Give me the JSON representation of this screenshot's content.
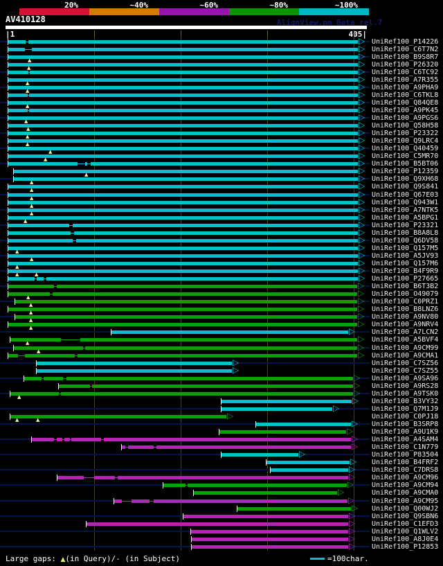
{
  "header": {
    "query_id": "AV410128",
    "app_credit": "AlignView.pm Beta rel.7",
    "ruler_left": "|1",
    "ruler_right": "405|"
  },
  "identity_scale": {
    "items": [
      {
        "label": "20%",
        "color": "#d01434"
      },
      {
        "label": "~40%",
        "color": "#d57a00"
      },
      {
        "label": "~60%",
        "color": "#9715ad"
      },
      {
        "label": "~80%",
        "color": "#0c9500"
      },
      {
        "label": "~100%",
        "color": "#00b6c4"
      }
    ]
  },
  "colors": {
    "cyan": "#00c2cc",
    "green": "#0aa004",
    "magenta": "#b524b5",
    "row_line": "#041348",
    "gridline": "#45451c",
    "query_gap_mark": "#f2f2a0",
    "label_text": "#f0f0f0"
  },
  "legend": {
    "gaps_prefix": "Large gaps: ",
    "gap_query_symbol": "▲",
    "gaps_mid": "(in Query)/",
    "gap_subject_symbol": "-",
    "gaps_suffix": " (in Subject)",
    "scale_label": "=100char."
  },
  "chart_data": {
    "type": "bar",
    "subtype": "sequence-alignment-overview",
    "title": "AV410128",
    "query": {
      "id": "AV410128",
      "length": 405
    },
    "axis": {
      "start": 1,
      "end": 405,
      "gridlines": [
        100,
        200,
        300,
        400
      ]
    },
    "identity_bins": [
      {
        "label": "20%",
        "color_key": "red"
      },
      {
        "label": "~40%",
        "color_key": "orange"
      },
      {
        "label": "~60%",
        "color_key": "magenta"
      },
      {
        "label": "~80%",
        "color_key": "green"
      },
      {
        "label": "~100%",
        "color_key": "cyan"
      }
    ],
    "rows": [
      {
        "label": "UniRef100_P14226",
        "color": "cyan",
        "identity": "~100%",
        "start": 1,
        "end": 405,
        "qg": [],
        "sg": [
          [
            21,
            24
          ]
        ]
      },
      {
        "label": "UniRef100_C6T7N2",
        "color": "cyan",
        "identity": "~100%",
        "start": 1,
        "end": 405,
        "qg": [],
        "sg": [
          [
            20,
            28
          ]
        ]
      },
      {
        "label": "UniRef100_B9S8R7",
        "color": "cyan",
        "identity": "~100%",
        "start": 1,
        "end": 405,
        "qg": [
          26
        ],
        "sg": []
      },
      {
        "label": "UniRef100_P26320",
        "color": "cyan",
        "identity": "~100%",
        "start": 1,
        "end": 405,
        "qg": [
          25
        ],
        "sg": []
      },
      {
        "label": "UniRef100_C6TC92",
        "color": "cyan",
        "identity": "~100%",
        "start": 1,
        "end": 405,
        "qg": [],
        "sg": [
          [
            24,
            26
          ]
        ]
      },
      {
        "label": "UniRef100_A7R355",
        "color": "cyan",
        "identity": "~100%",
        "start": 1,
        "end": 405,
        "qg": [
          23
        ],
        "sg": []
      },
      {
        "label": "UniRef100_A9PHA9",
        "color": "cyan",
        "identity": "~100%",
        "start": 1,
        "end": 405,
        "qg": [
          23
        ],
        "sg": []
      },
      {
        "label": "UniRef100_C6TKL8",
        "color": "cyan",
        "identity": "~100%",
        "start": 1,
        "end": 405,
        "qg": [],
        "sg": [
          [
            23,
            25
          ]
        ]
      },
      {
        "label": "UniRef100_Q84QE8",
        "color": "cyan",
        "identity": "~100%",
        "start": 1,
        "end": 405,
        "qg": [
          23
        ],
        "sg": []
      },
      {
        "label": "UniRef100_A9PK45",
        "color": "cyan",
        "identity": "~100%",
        "start": 1,
        "end": 405,
        "qg": [],
        "sg": [
          [
            23,
            24
          ]
        ]
      },
      {
        "label": "UniRef100_A9PGS6",
        "color": "cyan",
        "identity": "~100%",
        "start": 1,
        "end": 405,
        "qg": [
          22
        ],
        "sg": []
      },
      {
        "label": "UniRef100_Q58H58",
        "color": "cyan",
        "identity": "~100%",
        "start": 1,
        "end": 405,
        "qg": [
          24
        ],
        "sg": []
      },
      {
        "label": "UniRef100_P23322",
        "color": "cyan",
        "identity": "~100%",
        "start": 1,
        "end": 405,
        "qg": [
          23
        ],
        "sg": []
      },
      {
        "label": "UniRef100_Q9LRC4",
        "color": "cyan",
        "identity": "~100%",
        "start": 1,
        "end": 405,
        "qg": [
          23
        ],
        "sg": []
      },
      {
        "label": "UniRef100_Q40459",
        "color": "cyan",
        "identity": "~100%",
        "start": 1,
        "end": 405,
        "qg": [
          50
        ],
        "sg": []
      },
      {
        "label": "UniRef100_C5MR70",
        "color": "cyan",
        "identity": "~100%",
        "start": 1,
        "end": 405,
        "qg": [
          44
        ],
        "sg": []
      },
      {
        "label": "UniRef100_B5BT06",
        "color": "cyan",
        "identity": "~100%",
        "start": 1,
        "end": 405,
        "qg": [],
        "sg": [
          [
            81,
            90
          ],
          [
            92,
            96
          ]
        ]
      },
      {
        "label": "UniRef100_P12359",
        "color": "cyan",
        "identity": "~100%",
        "start": 7,
        "end": 405,
        "qg": [
          91
        ],
        "sg": []
      },
      {
        "label": "UniRef100_Q9XH68",
        "color": "cyan",
        "identity": "~100%",
        "start": 7,
        "end": 405,
        "qg": [
          28
        ],
        "sg": []
      },
      {
        "label": "UniRef100_Q9S841",
        "color": "cyan",
        "identity": "~100%",
        "start": 1,
        "end": 405,
        "qg": [
          28
        ],
        "sg": []
      },
      {
        "label": "UniRef100_Q67E03",
        "color": "cyan",
        "identity": "~100%",
        "start": 1,
        "end": 405,
        "qg": [
          28
        ],
        "sg": []
      },
      {
        "label": "UniRef100_Q943W1",
        "color": "cyan",
        "identity": "~100%",
        "start": 1,
        "end": 405,
        "qg": [
          28
        ],
        "sg": []
      },
      {
        "label": "UniRef100_A7NTK5",
        "color": "cyan",
        "identity": "~100%",
        "start": 1,
        "end": 405,
        "qg": [
          28
        ],
        "sg": []
      },
      {
        "label": "UniRef100_A5BPG1",
        "color": "cyan",
        "identity": "~100%",
        "start": 1,
        "end": 405,
        "qg": [
          21
        ],
        "sg": []
      },
      {
        "label": "UniRef100_P23321",
        "color": "cyan",
        "identity": "~100%",
        "start": 1,
        "end": 405,
        "qg": [],
        "sg": [
          [
            71,
            75
          ]
        ]
      },
      {
        "label": "UniRef100_B8A8L8",
        "color": "cyan",
        "identity": "~100%",
        "start": 1,
        "end": 405,
        "qg": [],
        "sg": [
          [
            73,
            77
          ]
        ]
      },
      {
        "label": "UniRef100_Q6DV58",
        "color": "cyan",
        "identity": "~100%",
        "start": 1,
        "end": 405,
        "qg": [],
        "sg": [
          [
            75,
            79
          ]
        ]
      },
      {
        "label": "UniRef100_Q157M5",
        "color": "cyan",
        "identity": "~100%",
        "start": 1,
        "end": 405,
        "qg": [
          11
        ],
        "sg": []
      },
      {
        "label": "UniRef100_A5JV93",
        "color": "cyan",
        "identity": "~100%",
        "start": 1,
        "end": 405,
        "qg": [
          28
        ],
        "sg": []
      },
      {
        "label": "UniRef100_Q157M6",
        "color": "cyan",
        "identity": "~100%",
        "start": 1,
        "end": 405,
        "qg": [
          11
        ],
        "sg": []
      },
      {
        "label": "UniRef100_B4F9R9",
        "color": "cyan",
        "identity": "~100%",
        "start": 1,
        "end": 405,
        "qg": [
          11,
          34
        ],
        "sg": []
      },
      {
        "label": "UniRef100_P27665",
        "color": "cyan",
        "identity": "~100%",
        "start": 1,
        "end": 405,
        "qg": [],
        "sg": [
          [
            31,
            34
          ],
          [
            42,
            45
          ]
        ]
      },
      {
        "label": "UniRef100_B6T3B2",
        "color": "green",
        "identity": "~80%",
        "start": 1,
        "end": 404,
        "qg": [],
        "sg": [
          [
            54,
            57
          ]
        ]
      },
      {
        "label": "UniRef100_O49079",
        "color": "green",
        "identity": "~80%",
        "start": 1,
        "end": 404,
        "qg": [
          24
        ],
        "sg": [
          [
            49,
            52
          ]
        ]
      },
      {
        "label": "UniRef100_C0PRZ1",
        "color": "green",
        "identity": "~80%",
        "start": 9,
        "end": 404,
        "qg": [
          27
        ],
        "sg": []
      },
      {
        "label": "UniRef100_B8LNZ6",
        "color": "green",
        "identity": "~80%",
        "start": 1,
        "end": 404,
        "qg": [
          27
        ],
        "sg": []
      },
      {
        "label": "UniRef100_A9NV80",
        "color": "green",
        "identity": "~80%",
        "start": 9,
        "end": 404,
        "qg": [
          27
        ],
        "sg": []
      },
      {
        "label": "UniRef100_A9NRV4",
        "color": "green",
        "identity": "~80%",
        "start": 1,
        "end": 404,
        "qg": [
          27
        ],
        "sg": []
      },
      {
        "label": "UniRef100_A7LCN2",
        "color": "cyan",
        "identity": "~100%",
        "start": 120,
        "end": 394,
        "qg": [],
        "sg": []
      },
      {
        "label": "UniRef100_A5BVF4",
        "color": "green",
        "identity": "~80%",
        "start": 3,
        "end": 404,
        "qg": [
          23
        ],
        "sg": [
          [
            62,
            84
          ]
        ]
      },
      {
        "label": "UniRef100_A9CM99",
        "color": "green",
        "identity": "~80%",
        "start": 7,
        "end": 404,
        "qg": [
          36
        ],
        "sg": [
          [
            87,
            90
          ]
        ]
      },
      {
        "label": "UniRef100_A9CMA1",
        "color": "green",
        "identity": "~80%",
        "start": 1,
        "end": 404,
        "qg": [],
        "sg": [
          [
            12,
            20
          ],
          [
            78,
            81
          ]
        ]
      },
      {
        "label": "UniRef100_C7SZ56",
        "color": "cyan",
        "identity": "~100%",
        "start": 34,
        "end": 259,
        "qg": [],
        "sg": []
      },
      {
        "label": "UniRef100_C7SZ55",
        "color": "cyan",
        "identity": "~100%",
        "start": 34,
        "end": 259,
        "qg": [],
        "sg": []
      },
      {
        "label": "UniRef100_A9SA96",
        "color": "green",
        "identity": "~80%",
        "start": 19,
        "end": 399,
        "qg": [],
        "sg": [
          [
            39,
            42
          ],
          [
            64,
            68
          ]
        ]
      },
      {
        "label": "UniRef100_A9RS28",
        "color": "green",
        "identity": "~80%",
        "start": 59,
        "end": 399,
        "qg": [],
        "sg": [
          [
            95,
            98
          ]
        ]
      },
      {
        "label": "UniRef100_A9TSK0",
        "color": "green",
        "identity": "~80%",
        "start": 3,
        "end": 399,
        "qg": [
          14
        ],
        "sg": [
          [
            59,
            62
          ]
        ]
      },
      {
        "label": "UniRef100_B3VY32",
        "color": "cyan",
        "identity": "~100%",
        "start": 247,
        "end": 398,
        "qg": [],
        "sg": []
      },
      {
        "label": "UniRef100_Q7M1J9",
        "color": "cyan",
        "identity": "~100%",
        "start": 247,
        "end": 375,
        "qg": [],
        "sg": []
      },
      {
        "label": "UniRef100_C0PJ18",
        "color": "green",
        "identity": "~80%",
        "start": 3,
        "end": 253,
        "qg": [
          11,
          35
        ],
        "sg": []
      },
      {
        "label": "UniRef100_B3SRP8",
        "color": "cyan",
        "identity": "~100%",
        "start": 287,
        "end": 397,
        "qg": [],
        "sg": []
      },
      {
        "label": "UniRef100_A9U1K9",
        "color": "green",
        "identity": "~80%",
        "start": 245,
        "end": 391,
        "qg": [],
        "sg": []
      },
      {
        "label": "UniRef100_A4SAM4",
        "color": "magenta",
        "identity": "~60%",
        "start": 28,
        "end": 397,
        "qg": [],
        "sg": [
          [
            54,
            57
          ],
          [
            63,
            66
          ],
          [
            72,
            74
          ],
          [
            108,
            111
          ]
        ]
      },
      {
        "label": "UniRef100_C1N779",
        "color": "magenta",
        "identity": "~60%",
        "start": 132,
        "end": 397,
        "qg": [],
        "sg": [
          [
            136,
            139
          ],
          [
            169,
            172
          ]
        ]
      },
      {
        "label": "UniRef100_P83504",
        "color": "cyan",
        "identity": "~100%",
        "start": 247,
        "end": 336,
        "qg": [],
        "sg": []
      },
      {
        "label": "UniRef100_B4FRF2",
        "color": "cyan",
        "identity": "~100%",
        "start": 299,
        "end": 395,
        "qg": [],
        "sg": []
      },
      {
        "label": "UniRef100_C7DRS8",
        "color": "cyan",
        "identity": "~100%",
        "start": 304,
        "end": 394,
        "qg": [],
        "sg": []
      },
      {
        "label": "UniRef100_A9CM96",
        "color": "magenta",
        "identity": "~60%",
        "start": 58,
        "end": 394,
        "qg": [],
        "sg": [
          [
            88,
            100
          ],
          [
            124,
            127
          ]
        ]
      },
      {
        "label": "UniRef100_A9CM94",
        "color": "green",
        "identity": "~80%",
        "start": 180,
        "end": 392,
        "qg": [],
        "sg": [
          [
            206,
            208
          ]
        ]
      },
      {
        "label": "UniRef100_A9CMA0",
        "color": "green",
        "identity": "~80%",
        "start": 215,
        "end": 381,
        "qg": [],
        "sg": []
      },
      {
        "label": "UniRef100_A9CM95",
        "color": "magenta",
        "identity": "~60%",
        "start": 123,
        "end": 393,
        "qg": [],
        "sg": [
          [
            132,
            143
          ],
          [
            164,
            169
          ]
        ]
      },
      {
        "label": "UniRef100_Q00WJ2",
        "color": "green",
        "identity": "~80%",
        "start": 266,
        "end": 397,
        "qg": [],
        "sg": []
      },
      {
        "label": "UniRef100_Q9SBN6",
        "color": "magenta",
        "identity": "~60%",
        "start": 203,
        "end": 394,
        "qg": [],
        "sg": []
      },
      {
        "label": "UniRef100_C1EFD3",
        "color": "magenta",
        "identity": "~60%",
        "start": 91,
        "end": 394,
        "qg": [],
        "sg": []
      },
      {
        "label": "UniRef100_Q1WLV2",
        "color": "magenta",
        "identity": "~60%",
        "start": 212,
        "end": 394,
        "qg": [],
        "sg": []
      },
      {
        "label": "UniRef100_A8J0E4",
        "color": "magenta",
        "identity": "~60%",
        "start": 213,
        "end": 394,
        "qg": [],
        "sg": []
      },
      {
        "label": "UniRef100_P12853",
        "color": "magenta",
        "identity": "~60%",
        "start": 213,
        "end": 394,
        "qg": [],
        "sg": []
      }
    ]
  }
}
